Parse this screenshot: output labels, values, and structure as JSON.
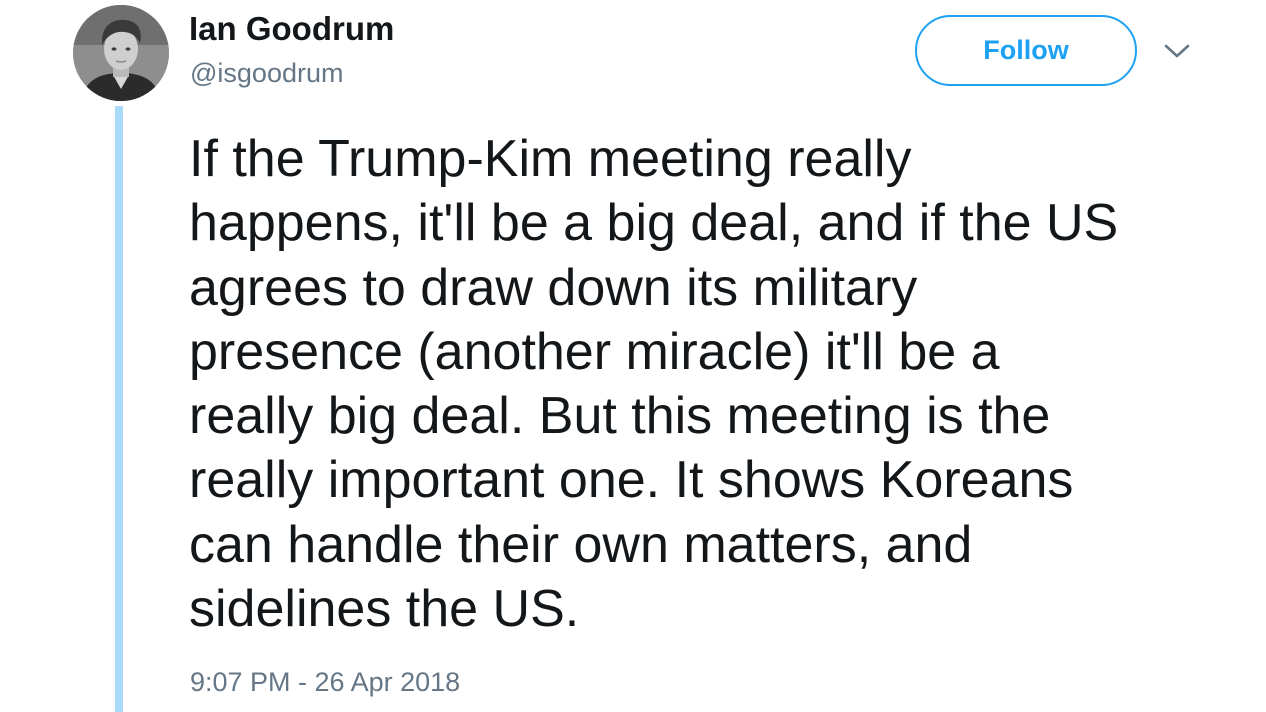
{
  "author": {
    "display_name": "Ian Goodrum",
    "handle": "@isgoodrum",
    "avatar_icon": "profile-photo"
  },
  "actions": {
    "follow_label": "Follow",
    "caret_icon": "chevron-down-icon"
  },
  "tweet": {
    "text": "If the Trump-Kim meeting really\nhappens, it'll be a big deal, and if the US\nagrees to draw down its military\npresence (another miracle) it'll be a\nreally big deal. But this meeting is the\nreally important one. It shows Koreans\ncan handle their own matters, and\nsidelines the US.",
    "timestamp": "9:07 PM - 26 Apr 2018"
  },
  "colors": {
    "accent": "#1da1f2",
    "secondary_text": "#657786",
    "primary_text": "#14171a",
    "thread_line": "#a9dbf8"
  }
}
